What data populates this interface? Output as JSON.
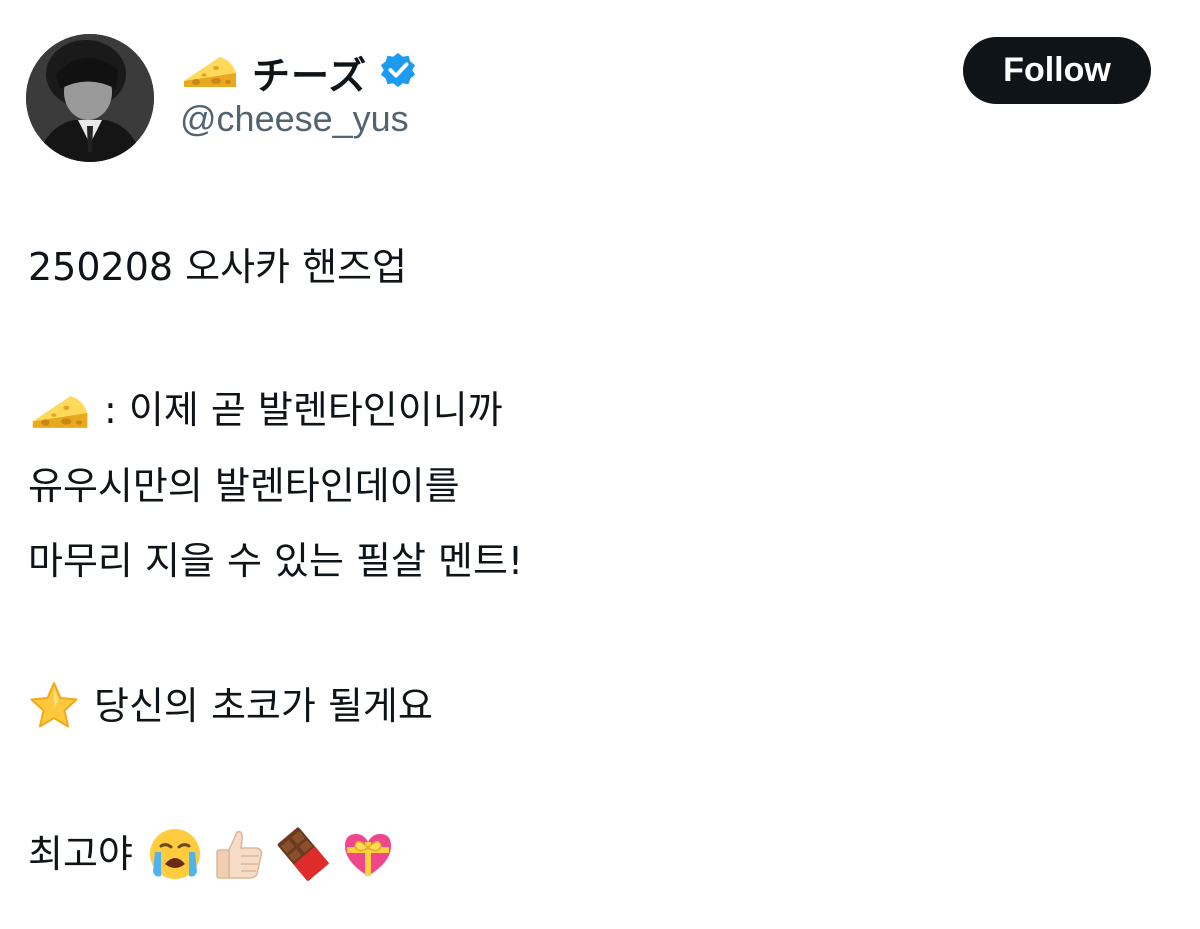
{
  "author": {
    "display_name": "チーズ",
    "name_icon": "cheese-emoji-icon",
    "verified_icon": "verified-badge-icon",
    "handle": "@cheese_yus",
    "avatar_icon": "profile-avatar"
  },
  "follow_button": {
    "label": "Follow"
  },
  "post": {
    "line1": "250208 오사카 핸즈업",
    "line2_text": ": 이제 곧 발렌타인이니까",
    "line2_icon": "cheese-emoji-icon",
    "line3": "유우시만의 발렌타인데이를",
    "line4": "마무리 지을 수 있는 필살 멘트!",
    "line5_icon": "star-emoji-icon",
    "line5_text": "당신의 초코가 될게요",
    "line6_text": "최고야",
    "line6_icons": [
      "crying-face-emoji-icon",
      "thumbs-up-emoji-icon",
      "chocolate-bar-emoji-icon",
      "heart-with-ribbon-emoji-icon"
    ]
  },
  "colors": {
    "text_primary": "#0f1419",
    "text_secondary": "#536471",
    "verified_blue": "#1d9bf0",
    "follow_bg": "#0f1419"
  }
}
